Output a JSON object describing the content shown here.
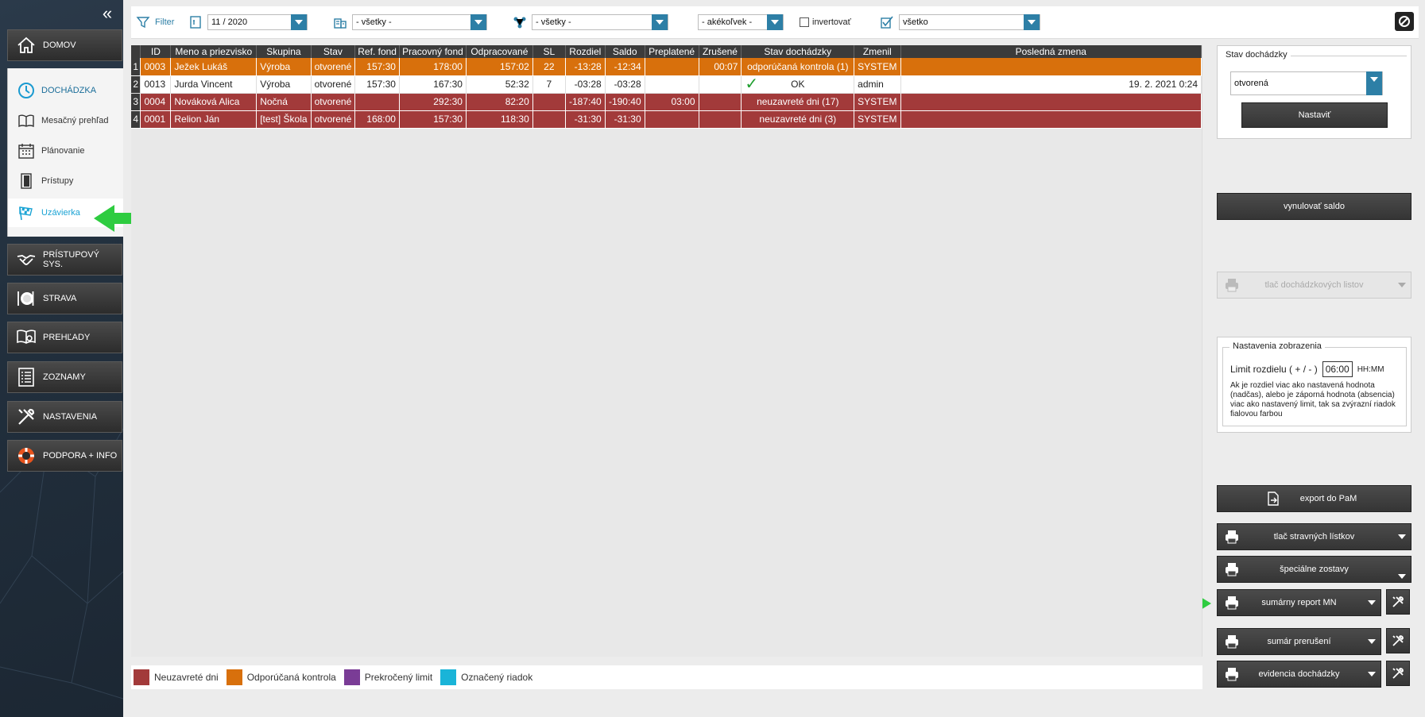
{
  "sidebar": {
    "collapse_icon": "double-chevron-left-icon",
    "main": [
      {
        "label": "DOMOV",
        "icon": "home-icon"
      },
      {
        "label": "PRÍSTUPOVÝ SYS.",
        "icon": "handshake-icon"
      },
      {
        "label": "STRAVA",
        "icon": "plate-icon"
      },
      {
        "label": "PREHĽADY",
        "icon": "book-search-icon"
      },
      {
        "label": "ZOZNAMY",
        "icon": "list-icon"
      },
      {
        "label": "NASTAVENIA",
        "icon": "tools-icon"
      },
      {
        "label": "PODPORA + INFO",
        "icon": "lifebuoy-icon"
      }
    ],
    "dochadzka": {
      "label": "DOCHÁDZKA",
      "items": [
        {
          "label": "Mesačný prehľad",
          "icon": "open-book-icon"
        },
        {
          "label": "Plánovanie",
          "icon": "calendar-icon"
        },
        {
          "label": "Prístupy",
          "icon": "door-icon"
        },
        {
          "label": "Uzávierka",
          "icon": "checkered-flag-icon",
          "active": true
        }
      ]
    }
  },
  "filterbar": {
    "filter_label": "Filter",
    "month": "11 / 2020",
    "department": "- všetky -",
    "group": "- všetky -",
    "any": "- akékoľvek -",
    "invert_label": "invertovať",
    "invert_checked": false,
    "scope": "všetko"
  },
  "table": {
    "columns": [
      "ID",
      "Meno a priezvisko",
      "Skupina",
      "Stav",
      "Ref. fond",
      "Pracovný fond",
      "Odpracované",
      "SL",
      "Rozdiel",
      "Saldo",
      "Preplatené",
      "Zrušené",
      "Stav dochádzky",
      "Zmenil",
      "Posledná zmena"
    ],
    "rows": [
      {
        "n": "1",
        "style": "orange",
        "cells": [
          "0003",
          "Ježek Lukáš",
          "Výroba",
          "otvorené",
          "157:30",
          "178:00",
          "157:02",
          "22",
          "-13:28",
          "-12:34",
          "",
          "00:07",
          "odporúčaná kontrola (1)",
          "SYSTEM",
          ""
        ]
      },
      {
        "n": "2",
        "style": "white",
        "cells": [
          "0013",
          "Jurda Vincent",
          "Výroba",
          "otvorené",
          "157:30",
          "167:30",
          "52:32",
          "7",
          "-03:28",
          "-03:28",
          "",
          "",
          "OK",
          "admin",
          "19. 2. 2021 0:24"
        ]
      },
      {
        "n": "3",
        "style": "red",
        "cells": [
          "0004",
          "Nováková Alica",
          "Nočná",
          "otvorené",
          "",
          "292:30",
          "82:20",
          "",
          "-187:40",
          "-190:40",
          "03:00",
          "",
          "neuzavreté dni (17)",
          "SYSTEM",
          ""
        ]
      },
      {
        "n": "4",
        "style": "red",
        "cells": [
          "0001",
          "Relion Ján",
          "[test] Škola",
          "otvorené",
          "168:00",
          "157:30",
          "118:30",
          "",
          "-31:30",
          "-31:30",
          "",
          "",
          "neuzavreté dni (3)",
          "SYSTEM",
          ""
        ]
      }
    ]
  },
  "legend": [
    {
      "label": "Neuzavreté dni",
      "color": "#a23a3a"
    },
    {
      "label": "Odporúčaná kontrola",
      "color": "#d8700c"
    },
    {
      "label": "Prekročený limit",
      "color": "#7a3c96"
    },
    {
      "label": "Označený riadok",
      "color": "#1ab4d8"
    }
  ],
  "right": {
    "stav_title": "Stav dochádzky",
    "stav_value": "otvorená",
    "set_btn": "Nastaviť",
    "reset_saldo": "vynulovať saldo",
    "print_sheets": "tlač dochádzkových listov",
    "display_title": "Nastavenia zobrazenia",
    "limit_label": "Limit rozdielu ( + / - )",
    "limit_value": "06:00",
    "limit_unit": "HH:MM",
    "limit_help": "Ak je rozdiel viac ako nastavená hodnota (nadčas), alebo je záporná hodnota (absencia) viac ako nastavený limit, tak sa zvýrazní riadok fialovou farbou",
    "export": "export do PaM",
    "meal": "tlač stravných lístkov",
    "special": "špeciálne zostavy",
    "summary": "sumárny report MN",
    "breaks": "sumár prerušení",
    "evidence": "evidencia dochádzky"
  },
  "colors": {
    "accent": "#2d7fa6",
    "orange": "#d8700c",
    "red": "#a23a3a",
    "arrow": "#2ecc40"
  }
}
